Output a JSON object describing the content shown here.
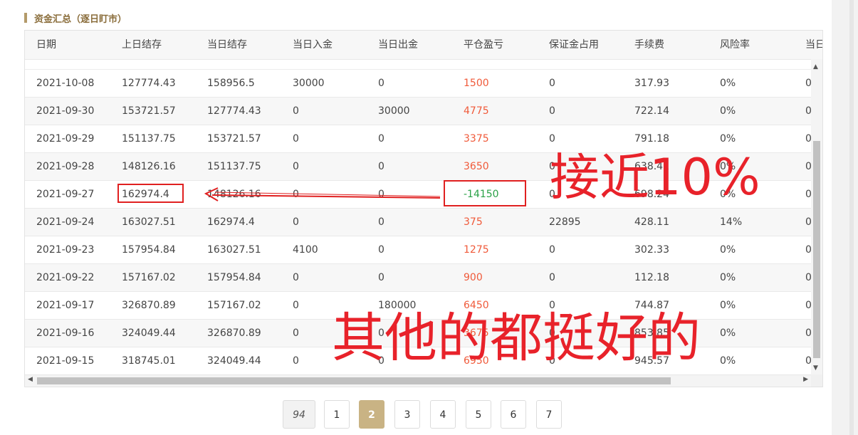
{
  "section": {
    "title": "资金汇总（逐日盯市）"
  },
  "table": {
    "columns": [
      "日期",
      "上日结存",
      "当日结存",
      "当日入金",
      "当日出金",
      "平仓盈亏",
      "保证金占用",
      "手续费",
      "风险率",
      "当日"
    ],
    "rows": [
      {
        "date": "2021-10-08",
        "prev": "127774.43",
        "curr": "158956.5",
        "deposit": "30000",
        "withdraw": "0",
        "pnl": "1500",
        "margin": "0",
        "fee": "317.93",
        "risk": "0%",
        "extra": "0"
      },
      {
        "date": "2021-09-30",
        "prev": "153721.57",
        "curr": "127774.43",
        "deposit": "0",
        "withdraw": "30000",
        "pnl": "4775",
        "margin": "0",
        "fee": "722.14",
        "risk": "0%",
        "extra": "0"
      },
      {
        "date": "2021-09-29",
        "prev": "151137.75",
        "curr": "153721.57",
        "deposit": "0",
        "withdraw": "0",
        "pnl": "3375",
        "margin": "0",
        "fee": "791.18",
        "risk": "0%",
        "extra": "0"
      },
      {
        "date": "2021-09-28",
        "prev": "148126.16",
        "curr": "151137.75",
        "deposit": "0",
        "withdraw": "0",
        "pnl": "3650",
        "margin": "0",
        "fee": "638.41",
        "risk": "0%",
        "extra": "0"
      },
      {
        "date": "2021-09-27",
        "prev": "162974.4",
        "curr": "148126.16",
        "deposit": "0",
        "withdraw": "0",
        "pnl": "-14150",
        "margin": "0",
        "fee": "698.24",
        "risk": "0%",
        "extra": "0"
      },
      {
        "date": "2021-09-24",
        "prev": "163027.51",
        "curr": "162974.4",
        "deposit": "0",
        "withdraw": "0",
        "pnl": "375",
        "margin": "22895",
        "fee": "428.11",
        "risk": "14%",
        "extra": "0"
      },
      {
        "date": "2021-09-23",
        "prev": "157954.84",
        "curr": "163027.51",
        "deposit": "4100",
        "withdraw": "0",
        "pnl": "1275",
        "margin": "0",
        "fee": "302.33",
        "risk": "0%",
        "extra": "0"
      },
      {
        "date": "2021-09-22",
        "prev": "157167.02",
        "curr": "157954.84",
        "deposit": "0",
        "withdraw": "0",
        "pnl": "900",
        "margin": "0",
        "fee": "112.18",
        "risk": "0%",
        "extra": "0"
      },
      {
        "date": "2021-09-17",
        "prev": "326870.89",
        "curr": "157167.02",
        "deposit": "0",
        "withdraw": "180000",
        "pnl": "6450",
        "margin": "0",
        "fee": "744.87",
        "risk": "0%",
        "extra": "0"
      },
      {
        "date": "2021-09-16",
        "prev": "324049.44",
        "curr": "326870.89",
        "deposit": "0",
        "withdraw": "0",
        "pnl": "3675",
        "margin": "0",
        "fee": "853.85",
        "risk": "0%",
        "extra": "0"
      },
      {
        "date": "2021-09-15",
        "prev": "318745.01",
        "curr": "324049.44",
        "deposit": "0",
        "withdraw": "0",
        "pnl": "6950",
        "margin": "0",
        "fee": "945.57",
        "risk": "0%",
        "extra": "0"
      }
    ]
  },
  "pagination": {
    "pages": [
      "94",
      "1",
      "2",
      "3",
      "4",
      "5",
      "6",
      "7"
    ],
    "active": "2"
  },
  "annotations": {
    "note_1": "接近10%",
    "note_2": "其他的都挺好的"
  },
  "colors": {
    "accent": "#c9b384",
    "pnl_positive": "#f05a3a",
    "pnl_negative": "#2aa147",
    "annotation": "#e8222a"
  },
  "icons": {
    "scroll_up": "triangle-up",
    "scroll_down": "triangle-down",
    "scroll_left": "triangle-left",
    "scroll_right": "triangle-right"
  }
}
